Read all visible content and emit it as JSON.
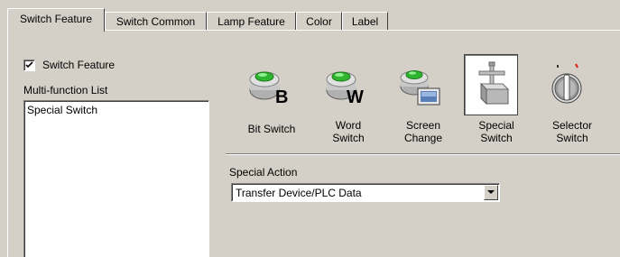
{
  "tabs": [
    {
      "label": "Switch Feature",
      "active": true
    },
    {
      "label": "Switch Common",
      "active": false
    },
    {
      "label": "Lamp Feature",
      "active": false
    },
    {
      "label": "Color",
      "active": false
    },
    {
      "label": "Label",
      "active": false
    }
  ],
  "switch_feature": {
    "label": "Switch Feature",
    "checked": true
  },
  "multi_function": {
    "label": "Multi-function List",
    "items": [
      "Special Switch"
    ]
  },
  "switch_types": [
    {
      "label": "Bit Switch",
      "icon": "bit-switch-icon",
      "selected": false
    },
    {
      "label": "Word\nSwitch",
      "icon": "word-switch-icon",
      "selected": false
    },
    {
      "label": "Screen\nChange",
      "icon": "screen-change-icon",
      "selected": false
    },
    {
      "label": "Special\nSwitch",
      "icon": "special-switch-icon",
      "selected": true
    },
    {
      "label": "Selector\nSwitch",
      "icon": "selector-switch-icon",
      "selected": false
    }
  ],
  "special_action": {
    "label": "Special Action",
    "value": "Transfer Device/PLC Data"
  },
  "colors": {
    "window_bg": "#d4d0c8",
    "green_button": "#33cc33",
    "selected_bg": "#ffffff"
  }
}
